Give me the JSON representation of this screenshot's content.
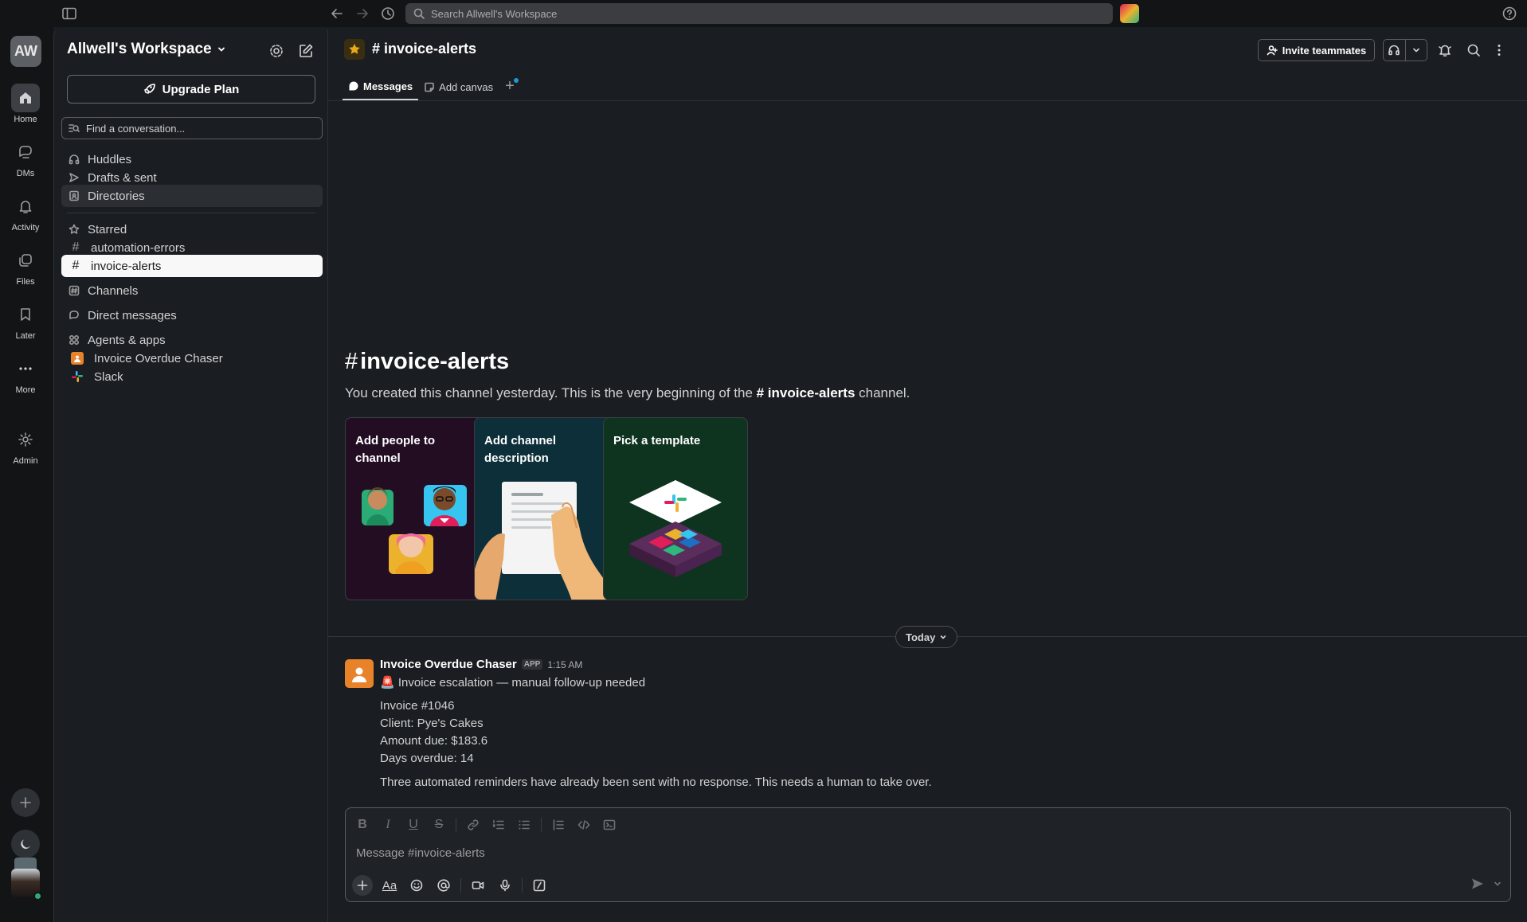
{
  "topbar": {
    "search_placeholder": "Search Allwell's Workspace"
  },
  "rail": {
    "workspace_initials": "AW",
    "items": [
      {
        "label": "Home",
        "icon": "home-icon"
      },
      {
        "label": "DMs",
        "icon": "dms-icon"
      },
      {
        "label": "Activity",
        "icon": "bell-icon"
      },
      {
        "label": "Files",
        "icon": "files-icon"
      },
      {
        "label": "Later",
        "icon": "bookmark-icon"
      },
      {
        "label": "More",
        "icon": "more-icon"
      },
      {
        "label": "Admin",
        "icon": "gear-icon"
      }
    ]
  },
  "sidebar": {
    "workspace_name": "Allwell's Workspace",
    "upgrade_label": "Upgrade Plan",
    "find_placeholder": "Find a conversation...",
    "nav": {
      "huddles": "Huddles",
      "drafts": "Drafts & sent",
      "directories": "Directories"
    },
    "starred": {
      "label": "Starred",
      "channels": [
        "automation-errors",
        "invoice-alerts"
      ]
    },
    "channels_label": "Channels",
    "dms_label": "Direct messages",
    "apps": {
      "label": "Agents & apps",
      "items": [
        "Invoice Overdue Chaser",
        "Slack"
      ]
    }
  },
  "header": {
    "channel_name": "invoice-alerts",
    "invite_label": "Invite teammates",
    "tabs": {
      "messages": "Messages",
      "canvas": "Add canvas"
    }
  },
  "intro": {
    "title": "invoice-alerts",
    "text_before": "You created this channel yesterday. This is the very beginning of the ",
    "channel_ref": "# invoice-alerts",
    "text_after": " channel."
  },
  "cards": {
    "add_people": "Add people to channel",
    "add_description": "Add channel description",
    "template": "Pick a template"
  },
  "divider": {
    "label": "Today"
  },
  "message": {
    "author": "Invoice Overdue Chaser",
    "badge": "APP",
    "time": "1:15 AM",
    "headline": "🚨 Invoice escalation — manual follow-up needed",
    "invoice": "Invoice #1046",
    "client": "Client: Pye's Cakes",
    "amount": "Amount due: $183.6",
    "days": "Days overdue: 14",
    "body": "Three automated reminders have already been sent with no response. This needs a human to take over."
  },
  "composer": {
    "placeholder": "Message #invoice-alerts",
    "font_label": "Aa"
  }
}
